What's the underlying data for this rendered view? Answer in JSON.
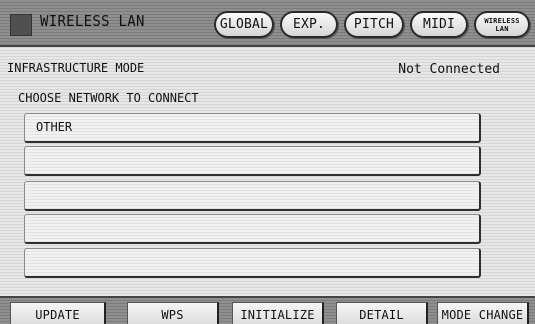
{
  "header": {
    "title": "WIRELESS LAN",
    "icon": "wireless-lan-icon",
    "tabs": [
      {
        "label": "GLOBAL"
      },
      {
        "label": "EXP."
      },
      {
        "label": "PITCH"
      },
      {
        "label": "MIDI"
      },
      {
        "label_line1": "WIRELESS",
        "label_line2": "LAN"
      }
    ]
  },
  "status": {
    "mode": "INFRASTRUCTURE MODE",
    "connection": "Not Connected"
  },
  "network_list": {
    "heading": "CHOOSE NETWORK TO CONNECT",
    "items": [
      {
        "label": "OTHER"
      },
      {
        "label": ""
      },
      {
        "label": ""
      },
      {
        "label": ""
      },
      {
        "label": ""
      }
    ]
  },
  "toolbar": {
    "buttons": [
      {
        "label": "UPDATE"
      },
      {
        "label": "WPS"
      },
      {
        "label": "INITIALIZE"
      },
      {
        "label": "DETAIL"
      },
      {
        "label": "MODE CHANGE"
      }
    ]
  }
}
